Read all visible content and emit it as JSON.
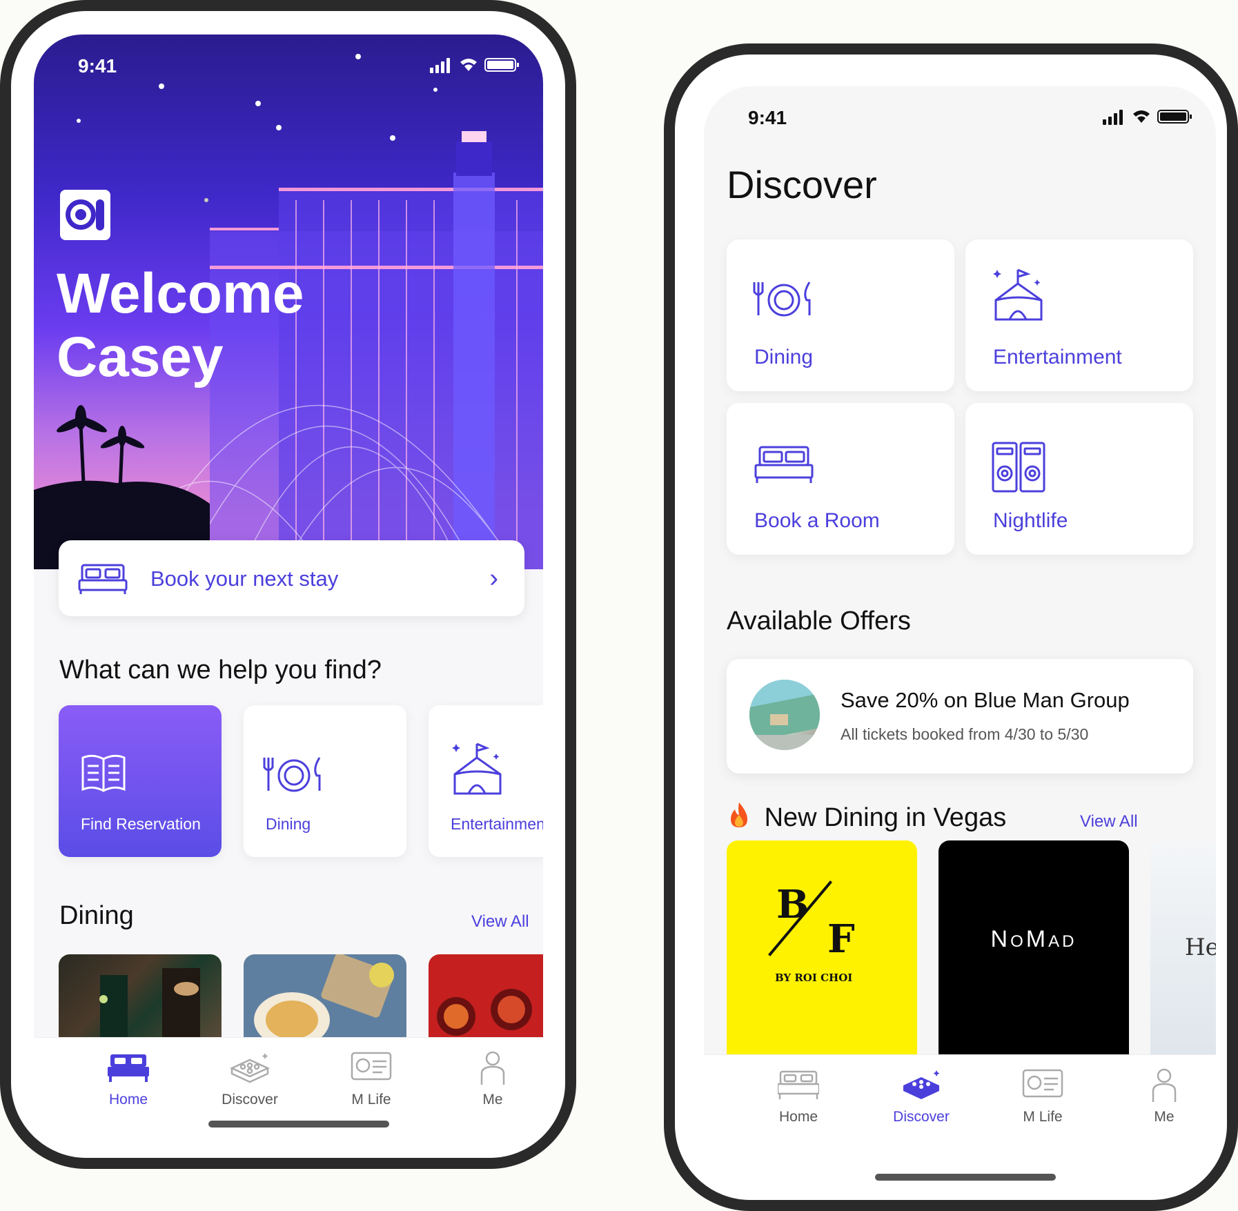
{
  "colors": {
    "accent": "#4b3fdc",
    "frame": "#2a2a2a",
    "tile_active_top": "#8a5cf6",
    "bf_yellow": "#fff200"
  },
  "phone1": {
    "status": {
      "time": "9:41"
    },
    "welcome_line1": "Welcome",
    "welcome_line2": "Casey",
    "book_stay": {
      "label": "Book your next stay",
      "icon": "bed-icon"
    },
    "help_heading": "What can we help you find?",
    "quick_tiles": [
      {
        "label": "Find Reservation",
        "icon": "book-icon",
        "active": true
      },
      {
        "label": "Dining",
        "icon": "dining-icon"
      },
      {
        "label": "Entertainmen",
        "icon": "tent-icon"
      }
    ],
    "dining_heading": "Dining",
    "dining_view_all": "View All",
    "tabs": [
      {
        "label": "Home",
        "icon": "bed-icon",
        "active": true
      },
      {
        "label": "Discover",
        "icon": "cake-icon"
      },
      {
        "label": "M Life",
        "icon": "card-icon"
      },
      {
        "label": "Me",
        "icon": "person-icon"
      }
    ]
  },
  "phone2": {
    "status": {
      "time": "9:41"
    },
    "title": "Discover",
    "categories": [
      {
        "label": "Dining",
        "icon": "dining-icon"
      },
      {
        "label": "Entertainment",
        "icon": "tent-icon"
      },
      {
        "label": "Book a Room",
        "icon": "bed-icon"
      },
      {
        "label": "Nightlife",
        "icon": "speakers-icon"
      }
    ],
    "offers_heading": "Available Offers",
    "offer": {
      "title": "Save 20% on Blue Man Group",
      "subtitle": "All tickets booked from 4/30 to 5/30"
    },
    "new_dining_heading": "New Dining in Vegas",
    "new_dining_view_all": "View All",
    "restaurants": [
      {
        "logo_b": "B",
        "logo_f": "F",
        "logo_by": "BY ROI CHOI"
      },
      {
        "logo": "NoMad"
      },
      {
        "logo": "He"
      }
    ],
    "tabs": [
      {
        "label": "Home",
        "icon": "bed-icon"
      },
      {
        "label": "Discover",
        "icon": "cake-icon",
        "active": true
      },
      {
        "label": "M Life",
        "icon": "card-icon"
      },
      {
        "label": "Me",
        "icon": "person-icon"
      }
    ]
  }
}
